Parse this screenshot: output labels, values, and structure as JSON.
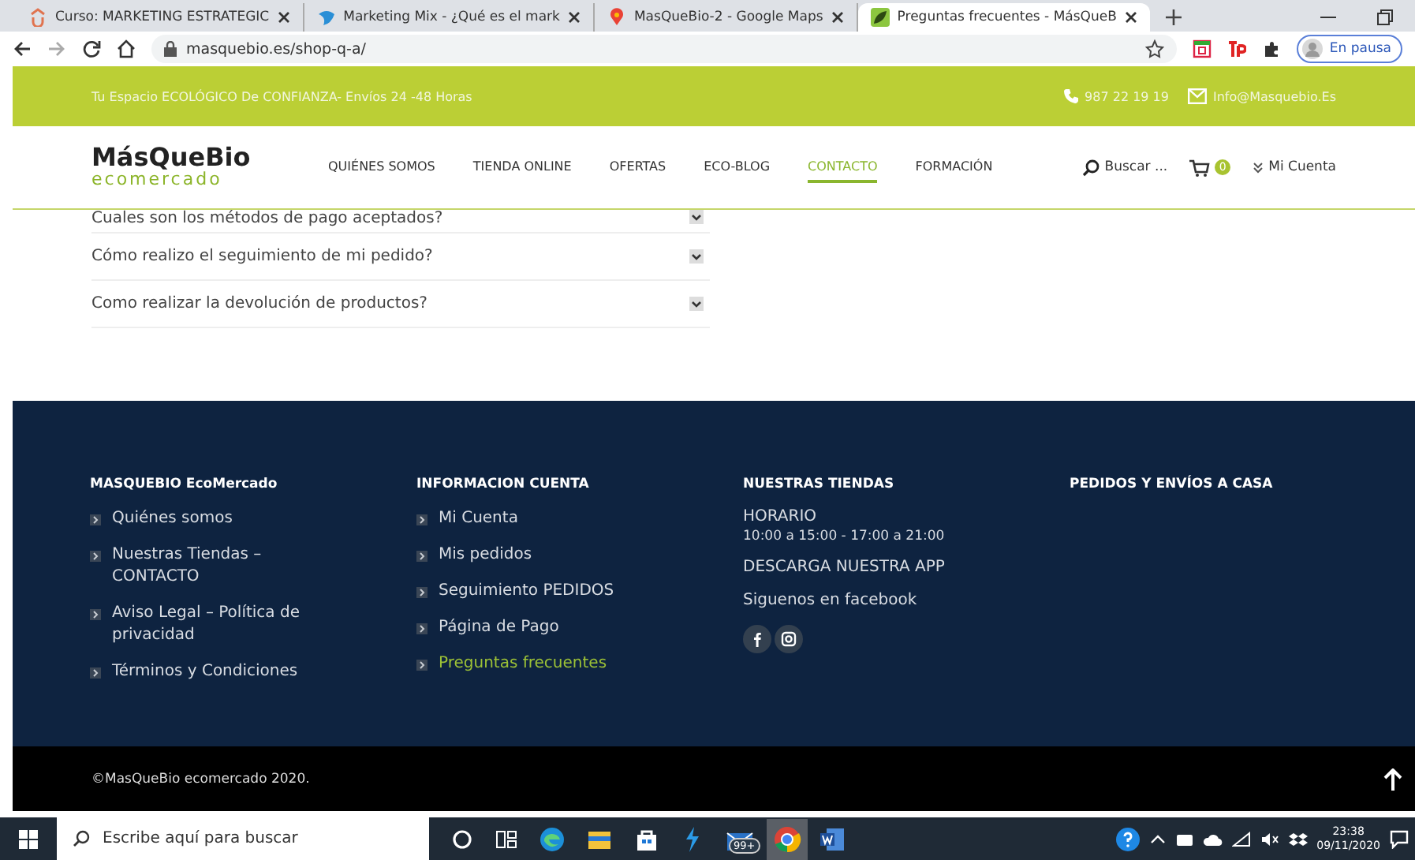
{
  "browser": {
    "tabs": [
      {
        "title": "Curso: MARKETING ESTRATEGIC",
        "selected": false
      },
      {
        "title": "Marketing Mix - ¿Qué es el mark",
        "selected": false
      },
      {
        "title": "MasQueBio-2 - Google Maps",
        "selected": false
      },
      {
        "title": "Preguntas frecuentes - MásQueB",
        "selected": true
      }
    ],
    "url": "masquebio.es/shop-q-a/",
    "profile_label": "En pausa"
  },
  "topbar": {
    "tagline": "Tu Espacio ECOLÓGICO De CONFIANZA- Envíos 24 -48 Horas",
    "phone": "987 22 19 19",
    "email": "Info@Masquebio.Es"
  },
  "header": {
    "logo_name": "MásQueBio",
    "logo_sub": "ecomercado",
    "nav": [
      {
        "label": "QUIÉNES SOMOS",
        "selected": false
      },
      {
        "label": "TIENDA ONLINE",
        "selected": false
      },
      {
        "label": "OFERTAS",
        "selected": false
      },
      {
        "label": "ECO-BLOG",
        "selected": false
      },
      {
        "label": "CONTACTO",
        "selected": true
      },
      {
        "label": "FORMACIÓN",
        "selected": false
      }
    ],
    "search": "Buscar ...",
    "cart_count": "0",
    "account": "Mi Cuenta"
  },
  "faq": [
    {
      "question": "Cuales son los métodos de pago aceptados?",
      "expanded": false
    },
    {
      "question": "Cómo realizo el seguimiento de mi pedido?",
      "expanded": false
    },
    {
      "question": "Como realizar la devolución de productos?",
      "expanded": false
    }
  ],
  "footer": {
    "columns": [
      {
        "heading": "MASQUEBIO EcoMercado",
        "kind": "links",
        "items": [
          {
            "label": "Quiénes somos",
            "selected": false
          },
          {
            "label": "Nuestras Tiendas – CONTACTO",
            "selected": false
          },
          {
            "label": "Aviso Legal – Política de privacidad",
            "selected": false
          },
          {
            "label": "Términos y Condiciones",
            "selected": false
          }
        ]
      },
      {
        "heading": "INFORMACION CUENTA",
        "kind": "links",
        "items": [
          {
            "label": "Mi Cuenta",
            "selected": false
          },
          {
            "label": "Mis pedidos",
            "selected": false
          },
          {
            "label": "Seguimiento PEDIDOS",
            "selected": false
          },
          {
            "label": "Página de Pago",
            "selected": false
          },
          {
            "label": "Preguntas frecuentes",
            "selected": true
          }
        ]
      },
      {
        "heading": "NUESTRAS TIENDAS",
        "kind": "stores",
        "lines": [
          {
            "text": "HORARIO",
            "kind": "label"
          },
          {
            "text": "10:00 a 15:00 - 17:00 a 21:00",
            "kind": "small"
          },
          {
            "text": "DESCARGA NUESTRA APP",
            "kind": "text"
          },
          {
            "text": "Siguenos en facebook",
            "kind": "text"
          }
        ]
      },
      {
        "heading": "PEDIDOS Y ENVÍOS A CASA",
        "kind": "heading"
      }
    ],
    "copyright": "©MasQueBio ecomercado 2020."
  },
  "taskbar": {
    "search_placeholder": "Escribe aquí para buscar",
    "mail_badge": "99+",
    "time": "23:38",
    "date": "09/11/2020"
  }
}
